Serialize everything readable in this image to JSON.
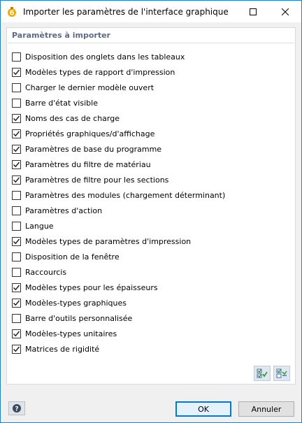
{
  "window": {
    "title": "Importer les paramètres de l'interface graphique",
    "accent_color": "#1883d7"
  },
  "panel": {
    "header": "Paramètres à importer",
    "options": [
      {
        "label": "Disposition des onglets dans les tableaux",
        "checked": false
      },
      {
        "label": "Modèles types de rapport d'impression",
        "checked": true
      },
      {
        "label": "Charger le dernier modèle ouvert",
        "checked": false
      },
      {
        "label": "Barre d'état visible",
        "checked": false
      },
      {
        "label": "Noms des cas de charge",
        "checked": true
      },
      {
        "label": "Propriétés graphiques/d'affichage",
        "checked": true
      },
      {
        "label": "Paramètres de base du programme",
        "checked": true
      },
      {
        "label": "Paramètres du filtre de matériau",
        "checked": true
      },
      {
        "label": "Paramètres de filtre pour les sections",
        "checked": true
      },
      {
        "label": "Paramètres des modules (chargement déterminant)",
        "checked": false
      },
      {
        "label": "Paramètres d'action",
        "checked": false
      },
      {
        "label": "Langue",
        "checked": false
      },
      {
        "label": "Modèles types de paramètres d'impression",
        "checked": true
      },
      {
        "label": "Disposition de la fenêtre",
        "checked": false
      },
      {
        "label": "Raccourcis",
        "checked": false
      },
      {
        "label": "Modèles types pour les épaisseurs",
        "checked": true
      },
      {
        "label": "Modèles-types graphiques",
        "checked": true
      },
      {
        "label": "Barre d'outils personnalisée",
        "checked": false
      },
      {
        "label": "Modèles-types unitaires",
        "checked": true
      },
      {
        "label": "Matrices de rigidité",
        "checked": true
      }
    ],
    "tools": {
      "select_all_icon": "check-all-icon",
      "deselect_all_icon": "uncheck-all-icon"
    }
  },
  "footer": {
    "help_icon": "help-icon",
    "ok_label": "OK",
    "cancel_label": "Annuler"
  }
}
